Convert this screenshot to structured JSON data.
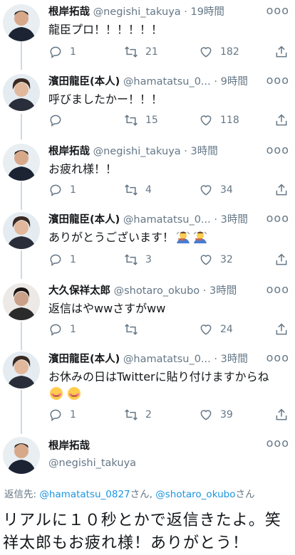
{
  "tweets": [
    {
      "name": "根岸拓哉",
      "handle": "@negishi_takuya",
      "time": "19時間",
      "text": "龍臣プロ！！！！！！",
      "replies": "1",
      "retweets": "21",
      "likes": "182"
    },
    {
      "name": "濱田龍臣(本人)",
      "handle": "@hamatatsu_0...",
      "time": "9時間",
      "text": "呼びましたかー！！！",
      "replies": "",
      "retweets": "15",
      "likes": "118"
    },
    {
      "name": "根岸拓哉",
      "handle": "@negishi_takuya",
      "time": "3時間",
      "text": "お疲れ様！！",
      "replies": "1",
      "retweets": "4",
      "likes": "34"
    },
    {
      "name": "濱田龍臣(本人)",
      "handle": "@hamatatsu_0...",
      "time": "3時間",
      "text": "ありがとうございます！",
      "replies": "1",
      "retweets": "3",
      "likes": "32"
    },
    {
      "name": "大久保祥太郎",
      "handle": "@shotaro_okubo",
      "time": "3時間",
      "text": "返信はやwwさすがww",
      "replies": "1",
      "retweets": "",
      "likes": "24"
    },
    {
      "name": "濱田龍臣(本人)",
      "handle": "@hamatatsu_0...",
      "time": "3時間",
      "text": "お休みの日はTwitterに貼り付けますからね",
      "replies": "1",
      "retweets": "2",
      "likes": "39"
    }
  ],
  "final_tweet": {
    "name": "根岸拓哉",
    "handle": "@negishi_takuya"
  },
  "reply_to": {
    "prefix": "返信先: ",
    "mention1": "@hamatatsu_0827",
    "suffix1": "さん, ",
    "mention2": "@shotaro_okubo",
    "suffix2": "さん"
  },
  "quote_text": "リアルに１０秒とかで返信きたよ。笑祥太郎もお疲れ様！ありがとう！",
  "dot": " · ",
  "more": "ooo",
  "icons": {
    "reply": "reply-icon",
    "retweet": "retweet-icon",
    "like": "like-icon",
    "share": "share-icon"
  },
  "colors": {
    "secondary": "#657786",
    "link": "#1b95e0",
    "line": "#cfd9de"
  }
}
